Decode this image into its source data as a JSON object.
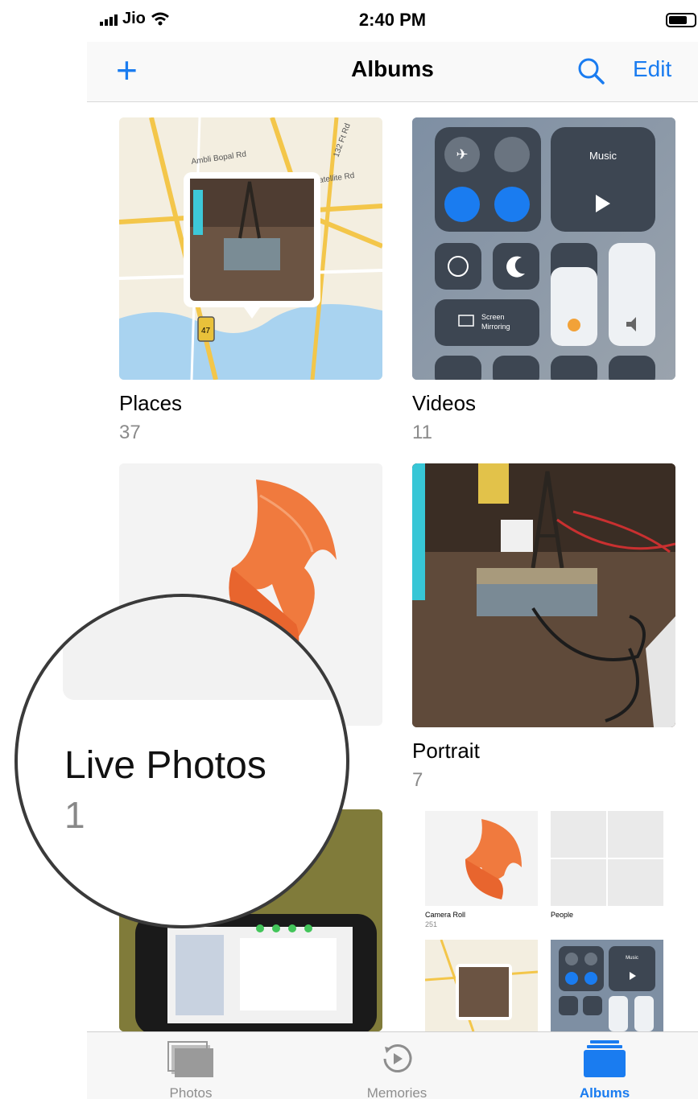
{
  "status_bar": {
    "carrier": "Jio",
    "time": "2:40 PM"
  },
  "nav": {
    "title": "Albums",
    "edit_label": "Edit",
    "add_icon": "plus-icon",
    "search_icon": "search-icon"
  },
  "albums": [
    {
      "name": "Places",
      "count": "37"
    },
    {
      "name": "Videos",
      "count": "11"
    },
    {
      "name": "Live Photos",
      "count": "1"
    },
    {
      "name": "Portrait",
      "count": "7"
    }
  ],
  "map_thumb": {
    "road_1": "Ambli Bopal Rd",
    "road_2": "Satellite Rd",
    "road_3": "132 Ft Rd",
    "route_badge": "47"
  },
  "control_center_thumb": {
    "music_label": "Music",
    "mirroring_line_1": "Screen",
    "mirroring_line_2": "Mirroring"
  },
  "nested_thumb": {
    "albums": [
      {
        "name": "Camera Roll",
        "count": "251"
      },
      {
        "name": "People",
        "count": ""
      }
    ],
    "music_label": "Music"
  },
  "tabs": [
    {
      "label": "Photos",
      "icon": "photos-icon",
      "active": false
    },
    {
      "label": "Memories",
      "icon": "memories-icon",
      "active": false
    },
    {
      "label": "Albums",
      "icon": "albums-icon",
      "active": true
    }
  ],
  "colors": {
    "accent": "#1a7cf0"
  }
}
